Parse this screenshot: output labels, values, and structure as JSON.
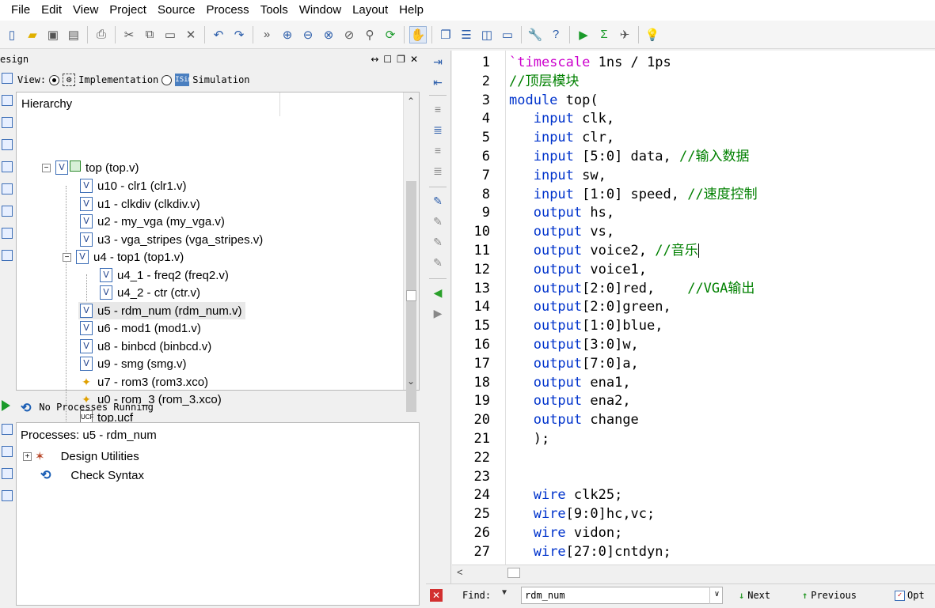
{
  "menu": [
    "File",
    "Edit",
    "View",
    "Project",
    "Source",
    "Process",
    "Tools",
    "Window",
    "Layout",
    "Help"
  ],
  "toolbar": {
    "icons": [
      "new-file-icon",
      "open-folder-icon",
      "save-icon",
      "save-all-icon",
      "print-icon",
      "cut-icon",
      "copy-icon",
      "paste-icon",
      "delete-icon",
      "undo-icon",
      "redo-icon",
      "overflow-icon",
      "zoom-in-icon",
      "zoom-out-icon",
      "zoom-fit-icon",
      "zoom-full-icon",
      "pin-icon",
      "refresh-icon",
      "pan-icon",
      "cascade-icon",
      "tile-h-icon",
      "tile-v-icon",
      "restore-icon",
      "wrench-icon",
      "help-icon",
      "run-icon",
      "sigma-icon",
      "telescope-icon",
      "bulb-icon"
    ]
  },
  "design": {
    "title": "esign",
    "view_label": "View:",
    "impl_label": "Implementation",
    "sim_label": "Simulation",
    "hierarchy_label": "Hierarchy",
    "tree": [
      {
        "label": "top (top.v)",
        "kind": "top"
      },
      {
        "label": "u10 - clr1 (clr1.v)",
        "kind": "v"
      },
      {
        "label": "u1 - clkdiv (clkdiv.v)",
        "kind": "v"
      },
      {
        "label": "u2 - my_vga (my_vga.v)",
        "kind": "v"
      },
      {
        "label": "u3 - vga_stripes (vga_stripes.v)",
        "kind": "v"
      },
      {
        "label": "u4 - top1 (top1.v)",
        "kind": "v"
      },
      {
        "label": "u4_1 - freq2 (freq2.v)",
        "kind": "v"
      },
      {
        "label": "u4_2 - ctr (ctr.v)",
        "kind": "v"
      },
      {
        "label": "u5 - rdm_num (rdm_num.v)",
        "kind": "v"
      },
      {
        "label": "u6 - mod1 (mod1.v)",
        "kind": "v"
      },
      {
        "label": "u8 - binbcd (binbcd.v)",
        "kind": "v"
      },
      {
        "label": "u9 - smg (smg.v)",
        "kind": "v"
      },
      {
        "label": "u7 - rom3 (rom3.xco)",
        "kind": "xco"
      },
      {
        "label": "u0 - rom_3 (rom_3.xco)",
        "kind": "xco"
      },
      {
        "label": "top.ucf",
        "kind": "ucf"
      }
    ]
  },
  "processes": {
    "status": "No Processes Running",
    "header": "Processes: u5 - rdm_num",
    "items": [
      "Design Utilities",
      "Check Syntax"
    ]
  },
  "editor": {
    "lines": [
      "`timescale 1ns / 1ps",
      "//顶层模块",
      "module top(",
      "   input clk,",
      "   input clr,",
      "   input [5:0] data, //输入数据",
      "   input sw,",
      "   input [1:0] speed, //速度控制",
      "   output hs,",
      "   output vs,",
      "   output voice2, //音乐",
      "   output voice1,",
      "   output[2:0]red,    //VGA输出",
      "   output[2:0]green,",
      "   output[1:0]blue,",
      "   output[3:0]w,",
      "   output[7:0]a,",
      "   output ena1,",
      "   output ena2,",
      "   output change",
      "   );",
      "",
      "",
      "   wire clk25;",
      "   wire[9:0]hc,vc;",
      "   wire vidon;",
      "   wire[27:0]cntdyn;"
    ]
  },
  "find": {
    "label": "Find:",
    "value": "rdm_num",
    "next_label": "Next",
    "prev_label": "Previous",
    "opt_label": "Opt"
  }
}
